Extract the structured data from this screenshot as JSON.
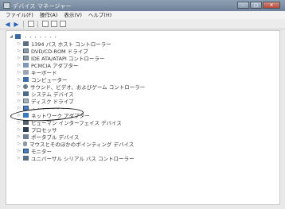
{
  "window": {
    "title": "デバイス マネージャー",
    "buttons": {
      "minimize": "–",
      "maximize": "□",
      "close": "✕"
    }
  },
  "menu": [
    "ファイル(F)",
    "操作(A)",
    "表示(V)",
    "ヘルプ(H)"
  ],
  "tree": {
    "root_label": "・・・・・・・",
    "items": [
      {
        "label": "1394 バス ホスト コントローラー",
        "icon": "usb-icon"
      },
      {
        "label": "DVD/CD-ROM ドライブ",
        "icon": "drive-icon"
      },
      {
        "label": "IDE ATA/ATAPI コントローラー",
        "icon": "drive-icon"
      },
      {
        "label": "PCMCIA アダプター",
        "icon": "card-icon"
      },
      {
        "label": "キーボード",
        "icon": "keyboard-icon"
      },
      {
        "label": "コンピューター",
        "icon": "computer-icon"
      },
      {
        "label": "サウンド、ビデオ、およびゲーム コントローラー",
        "icon": "sound-icon"
      },
      {
        "label": "システム デバイス",
        "icon": "system-icon"
      },
      {
        "label": "ディスク ドライブ",
        "icon": "disk-icon"
      },
      {
        "label": "・・・・・・・",
        "icon": "display-icon"
      },
      {
        "label": "ネットワーク アダプター",
        "icon": "network-icon"
      },
      {
        "label": "ヒューマン インターフェイス デバイス",
        "icon": "hid-icon"
      },
      {
        "label": "プロセッサ",
        "icon": "processor-icon"
      },
      {
        "label": "ポータブル デバイス",
        "icon": "portable-icon"
      },
      {
        "label": "マウスとそのほかのポインティング デバイス",
        "icon": "mouse-icon"
      },
      {
        "label": "モニター",
        "icon": "monitor-icon"
      },
      {
        "label": "ユニバーサル シリアル バス コントローラー",
        "icon": "usb-icon"
      }
    ]
  }
}
